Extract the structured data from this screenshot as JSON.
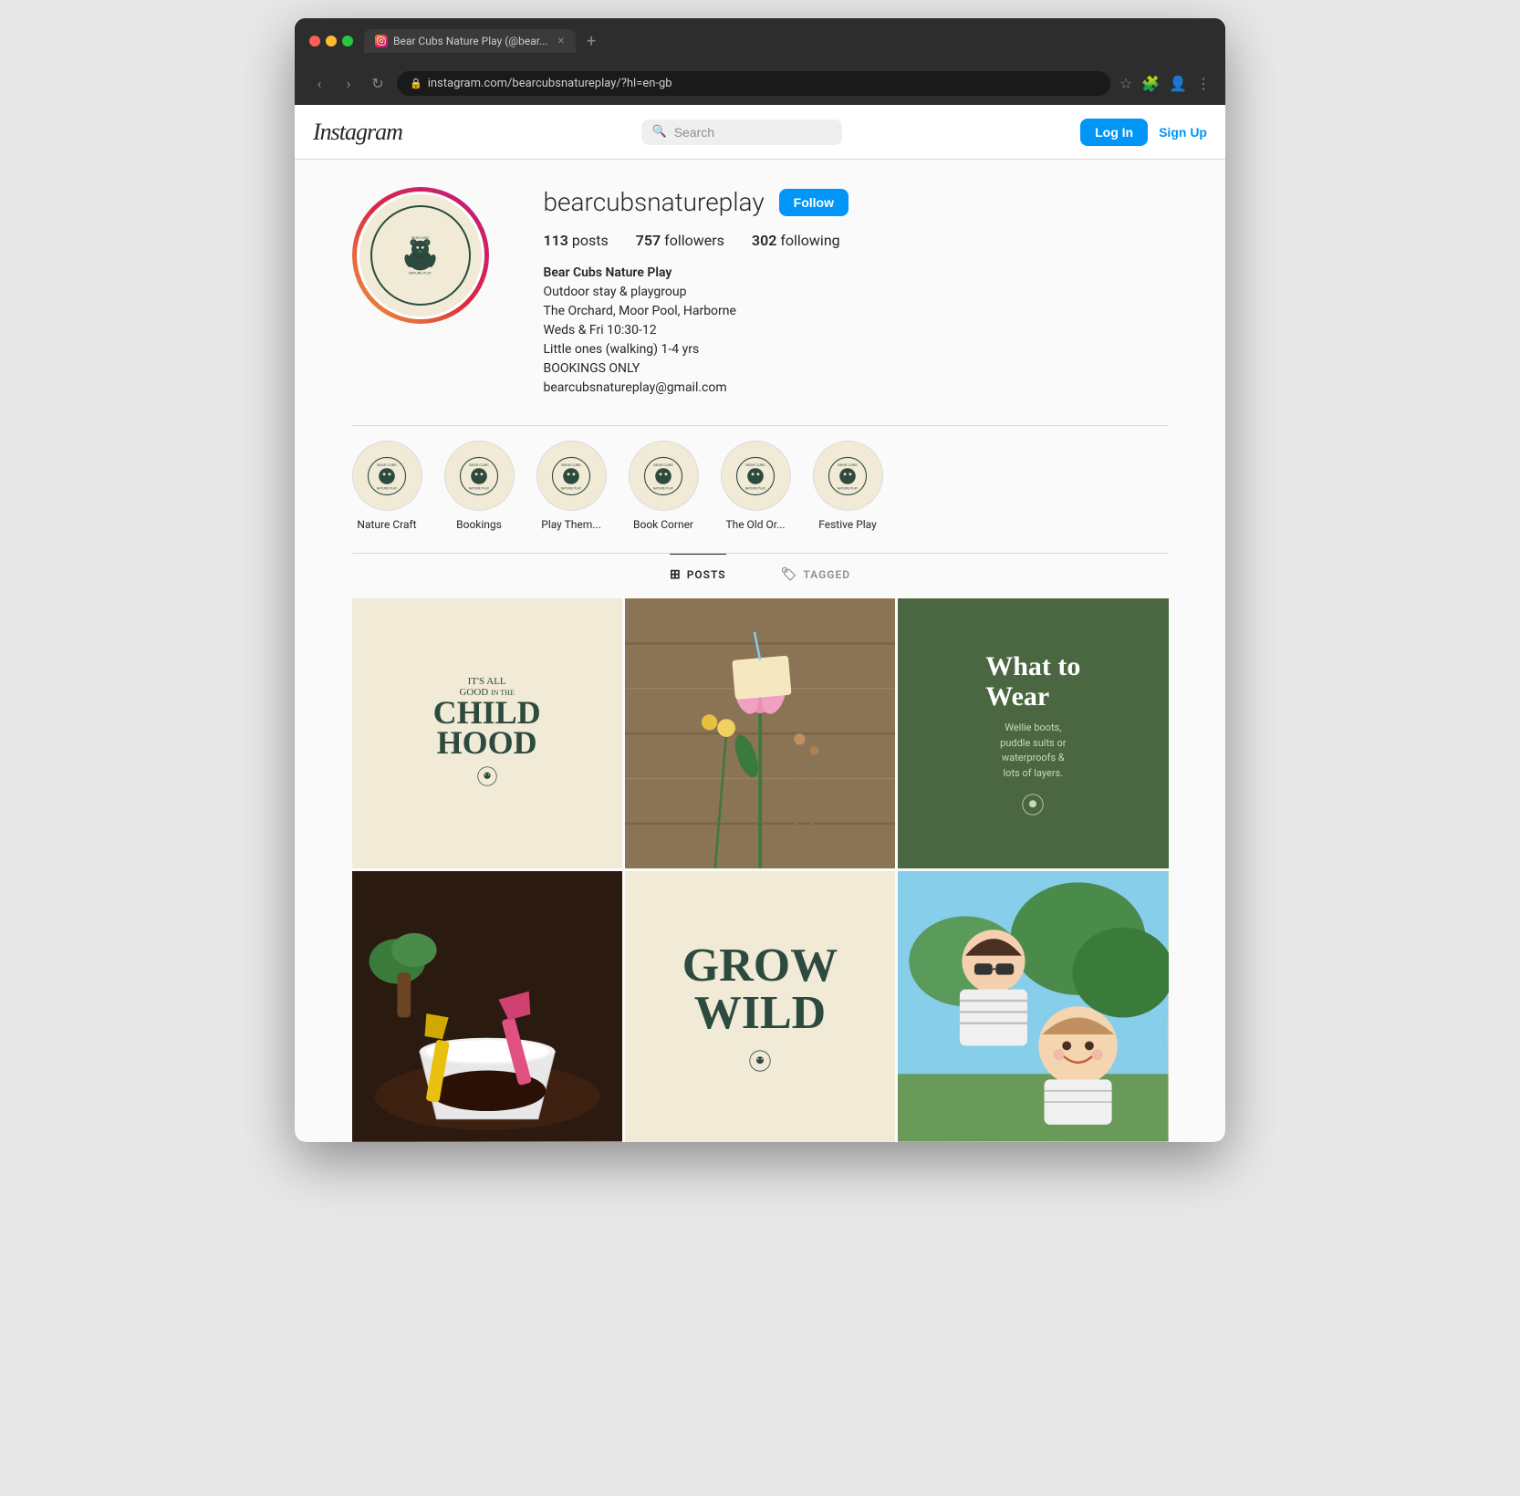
{
  "browser": {
    "tab_title": "Bear Cubs Nature Play (@bear...",
    "tab_favicon_alt": "instagram-favicon",
    "address": "instagram.com/bearcubsnatureplay/?hl=en-gb",
    "nav": {
      "back": "‹",
      "forward": "›",
      "refresh": "↻"
    }
  },
  "header": {
    "logo": "Instagram",
    "search_placeholder": "Search",
    "login_label": "Log In",
    "signup_label": "Sign Up"
  },
  "profile": {
    "username": "bearcubsnatureplay",
    "follow_label": "Follow",
    "stats": {
      "posts_count": "113",
      "posts_label": "posts",
      "followers_count": "757",
      "followers_label": "followers",
      "following_count": "302",
      "following_label": "following"
    },
    "bio": {
      "name": "Bear Cubs Nature Play",
      "line1": "Outdoor stay & playgroup",
      "line2": "The Orchard, Moor Pool, Harborne",
      "line3": "Weds & Fri 10:30-12",
      "line4": "Little ones (walking) 1-4 yrs",
      "line5": "BOOKINGS ONLY",
      "line6": "bearcubsnatureplay@gmail.com"
    }
  },
  "highlights": [
    {
      "label": "Nature Craft"
    },
    {
      "label": "Bookings"
    },
    {
      "label": "Play Them..."
    },
    {
      "label": "Book Corner"
    },
    {
      "label": "The Old Or..."
    },
    {
      "label": "Festive Play"
    }
  ],
  "tabs": [
    {
      "id": "posts",
      "label": "POSTS",
      "icon": "⊞",
      "active": true
    },
    {
      "id": "tagged",
      "label": "TAGGED",
      "icon": "🏷",
      "active": false
    }
  ],
  "posts": [
    {
      "id": "post-1",
      "type": "text-graphic",
      "lines": [
        "IT'S ALL",
        "GOOD IN THE",
        "CHILD",
        "HOOD"
      ],
      "bg": "#f0ead6",
      "text_color": "#2d4a3e"
    },
    {
      "id": "post-2",
      "type": "photo",
      "description": "Flowers arrangement with tulip"
    },
    {
      "id": "post-3",
      "type": "text-graphic",
      "title": "What to Wear",
      "body": "Wellie boots, puddle suits or waterproofs & lots of layers.",
      "bg": "#4a6741",
      "text_color": "#ffffff"
    },
    {
      "id": "post-4",
      "type": "photo",
      "description": "Gardening with white bucket and soil"
    },
    {
      "id": "post-5",
      "type": "text-graphic",
      "lines": [
        "GROW",
        "WILD"
      ],
      "bg": "#f0ead6",
      "text_color": "#2d4a3e"
    },
    {
      "id": "post-6",
      "type": "photo",
      "description": "Woman and child outdoors smiling"
    }
  ]
}
